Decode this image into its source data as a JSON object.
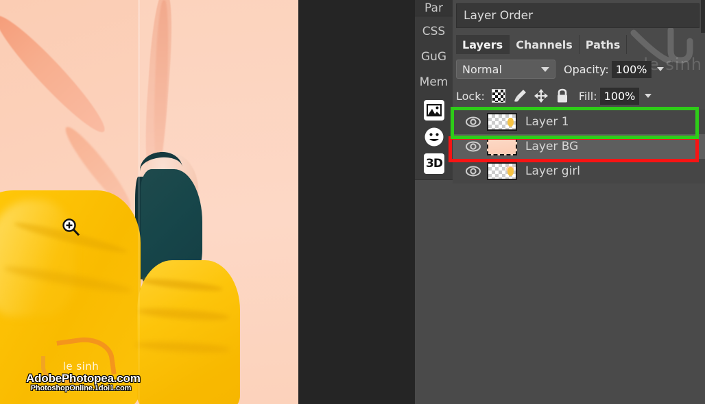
{
  "app": {
    "name": "photopea-layers-panel"
  },
  "canvas": {
    "cursor_icon": "zoom-in-magnifier-icon",
    "watermark": {
      "line1": "le sinh",
      "line2": "AdobePhotopea.com",
      "line3": "PhotoshopOnline.1doi1.com"
    }
  },
  "rail": {
    "labels": [
      {
        "text": "Par"
      },
      {
        "text": "CSS"
      },
      {
        "text": "GuG"
      },
      {
        "text": "Mem"
      }
    ],
    "icons": [
      {
        "name": "image-icon",
        "label": ""
      },
      {
        "name": "smiley-icon",
        "label": ""
      },
      {
        "name": "3d-icon",
        "label": "3D"
      }
    ]
  },
  "panel": {
    "title": "Layer Order",
    "watermark_text": "le sinh",
    "tabs": [
      {
        "label": "Layers",
        "active": true
      },
      {
        "label": "Channels",
        "active": false
      },
      {
        "label": "Paths",
        "active": false
      }
    ],
    "blend": {
      "mode": "Normal",
      "opacity_label": "Opacity:",
      "opacity_value": "100%"
    },
    "lock": {
      "label": "Lock:",
      "icons": [
        {
          "name": "lock-transparency-icon"
        },
        {
          "name": "lock-image-brush-icon"
        },
        {
          "name": "lock-position-move-icon"
        },
        {
          "name": "lock-all-padlock-icon"
        }
      ],
      "fill_label": "Fill:",
      "fill_value": "100%"
    },
    "layers": [
      {
        "name": "Layer 1",
        "visible": true,
        "selected": false,
        "thumb": "checker-yellow",
        "highlight": "green"
      },
      {
        "name": "Layer BG",
        "visible": true,
        "selected": true,
        "thumb": "peach-gradient",
        "highlight": "red"
      },
      {
        "name": "Layer girl",
        "visible": true,
        "selected": false,
        "thumb": "checker-girl",
        "highlight": "none"
      }
    ]
  },
  "colors": {
    "panel_bg": "#4a4a4a",
    "rail_bg": "#3b3b3b",
    "canvas_bg": "#252525",
    "row_selected": "#5e5e5e",
    "row_normal": "#464646",
    "highlight_green": "#2ecc18",
    "highlight_red": "#f71414",
    "photo_background": "#fbd0b9",
    "dress_yellow": "#fcc20a",
    "top_teal": "#174449"
  }
}
